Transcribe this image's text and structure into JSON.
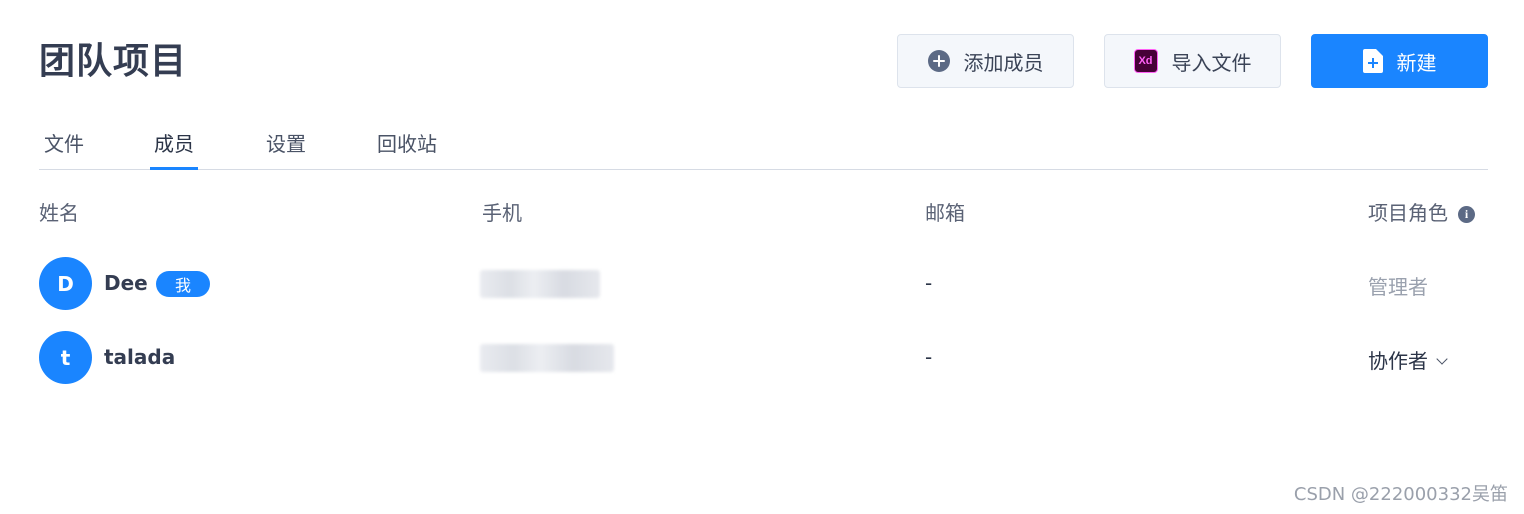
{
  "header": {
    "title": "团队项目",
    "buttons": {
      "add_member": "添加成员",
      "import_file": "导入文件",
      "import_icon_text": "Xd",
      "new": "新建"
    }
  },
  "tabs": [
    "文件",
    "成员",
    "设置",
    "回收站"
  ],
  "active_tab": "成员",
  "table": {
    "columns": {
      "name": "姓名",
      "phone": "手机",
      "email": "邮箱",
      "role": "项目角色"
    },
    "info_icon": "i",
    "rows": [
      {
        "avatar": "D",
        "name": "Dee",
        "badge": "我",
        "email": "-",
        "role": "管理者"
      },
      {
        "avatar": "t",
        "name": "talada",
        "email": "-",
        "role": "协作者"
      }
    ]
  },
  "watermark": "CSDN @222000332吴笛",
  "colors": {
    "primary": "#1a85ff",
    "title": "#343d52",
    "muted": "#9aa1ae"
  },
  "icons": [
    "plus-circle-icon",
    "xd-icon",
    "document-plus-icon",
    "info-icon",
    "chevron-down-icon"
  ]
}
